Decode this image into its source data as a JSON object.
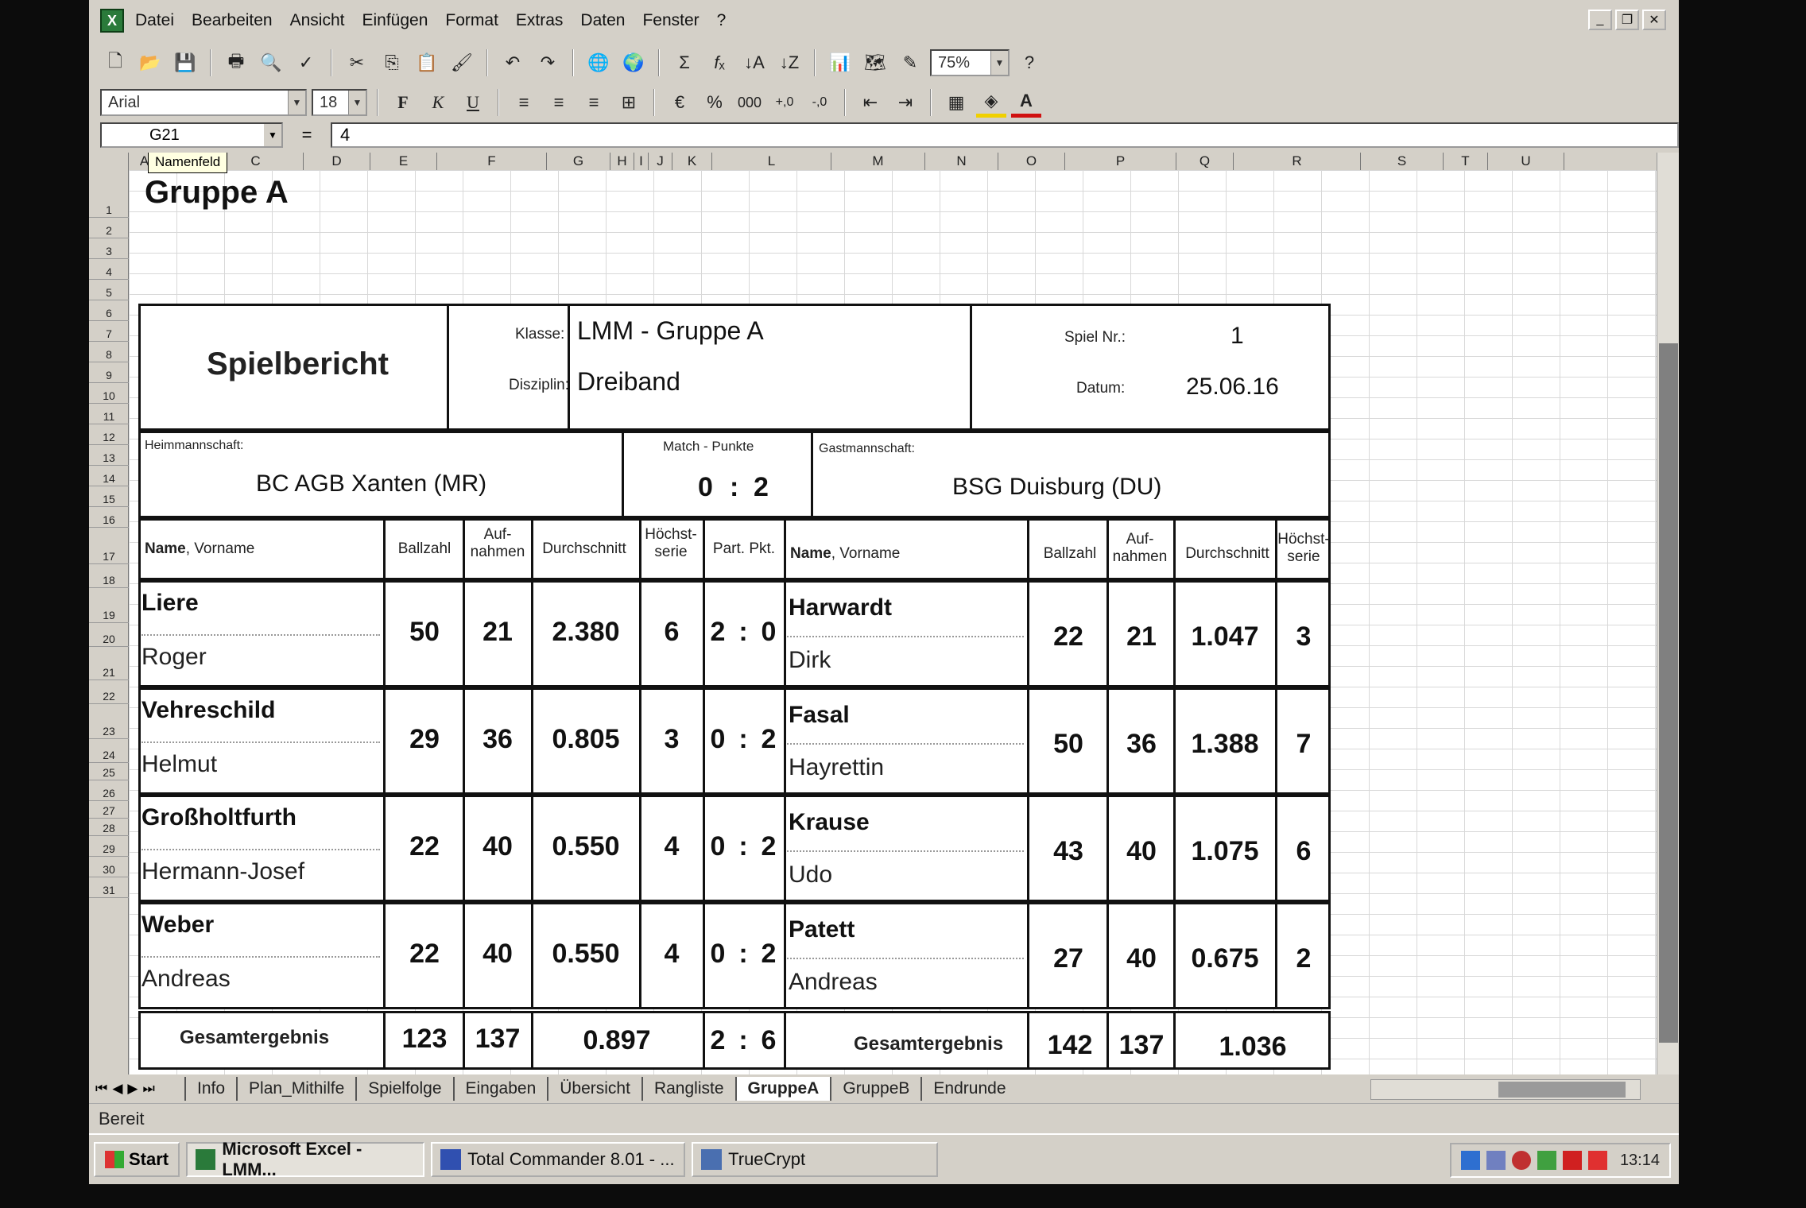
{
  "menu": [
    "Datei",
    "Bearbeiten",
    "Ansicht",
    "Einfügen",
    "Format",
    "Extras",
    "Daten",
    "Fenster",
    "?"
  ],
  "toolbar": {
    "zoom": "75%",
    "font_name": "Arial",
    "font_size": "18",
    "bold": "F",
    "italic": "K",
    "underline": "U"
  },
  "formula_bar": {
    "name_box": "G21",
    "equals": "=",
    "value": "4",
    "tooltip": "Namenfeld"
  },
  "columns": [
    "A",
    "B",
    "C",
    "D",
    "E",
    "F",
    "G",
    "H",
    "I",
    "J",
    "K",
    "L",
    "M",
    "N",
    "O",
    "P",
    "Q",
    "R",
    "S",
    "T",
    "U"
  ],
  "rows": [
    "1",
    "2",
    "3",
    "4",
    "5",
    "6",
    "7",
    "8",
    "9",
    "10",
    "11",
    "12",
    "13",
    "14",
    "15",
    "16",
    "17",
    "18",
    "19",
    "20",
    "21",
    "22",
    "23",
    "24",
    "25",
    "26",
    "27",
    "28",
    "29",
    "30",
    "31"
  ],
  "report": {
    "group_title": "Gruppe A",
    "title": "Spielbericht",
    "klasse_label": "Klasse:",
    "klasse": "LMM - Gruppe A",
    "disziplin_label": "Disziplin:",
    "disziplin": "Dreiband",
    "spiel_nr_label": "Spiel Nr.:",
    "spiel_nr": "1",
    "datum_label": "Datum:",
    "datum": "25.06.16",
    "heim_label": "Heimmannschaft:",
    "heim": "BC AGB Xanten (MR)",
    "match_label": "Match - Punkte",
    "match_home": "0",
    "match_sep": ":",
    "match_away": "2",
    "gast_label": "Gastmannschaft:",
    "gast": "BSG Duisburg (DU)",
    "headers": {
      "name": "Name",
      "vorname": ", Vorname",
      "ballzahl": "Ballzahl",
      "aufnahmen_1": "Auf-",
      "aufnahmen_2": "nahmen",
      "durchschnitt": "Durchschnitt",
      "hoechst_1": "Höchst-",
      "hoechst_2": "serie",
      "partpkt": "Part. Pkt."
    },
    "matches": [
      {
        "home": {
          "surname": "Liere",
          "firstname": "Roger",
          "ballzahl": "50",
          "aufnahmen": "21",
          "durchschnitt": "2.380",
          "hs": "6"
        },
        "pp_home": "2",
        "pp_away": "0",
        "away": {
          "surname": "Harwardt",
          "firstname": "Dirk",
          "ballzahl": "22",
          "aufnahmen": "21",
          "durchschnitt": "1.047",
          "hs": "3"
        }
      },
      {
        "home": {
          "surname": "Vehreschild",
          "firstname": "Helmut",
          "ballzahl": "29",
          "aufnahmen": "36",
          "durchschnitt": "0.805",
          "hs": "3"
        },
        "pp_home": "0",
        "pp_away": "2",
        "away": {
          "surname": "Fasal",
          "firstname": "Hayrettin",
          "ballzahl": "50",
          "aufnahmen": "36",
          "durchschnitt": "1.388",
          "hs": "7"
        }
      },
      {
        "home": {
          "surname": "Großholtfurth",
          "firstname": "Hermann-Josef",
          "ballzahl": "22",
          "aufnahmen": "40",
          "durchschnitt": "0.550",
          "hs": "4"
        },
        "pp_home": "0",
        "pp_away": "2",
        "away": {
          "surname": "Krause",
          "firstname": "Udo",
          "ballzahl": "43",
          "aufnahmen": "40",
          "durchschnitt": "1.075",
          "hs": "6"
        }
      },
      {
        "home": {
          "surname": "Weber",
          "firstname": "Andreas",
          "ballzahl": "22",
          "aufnahmen": "40",
          "durchschnitt": "0.550",
          "hs": "4"
        },
        "pp_home": "0",
        "pp_away": "2",
        "away": {
          "surname": "Patett",
          "firstname": "Andreas",
          "ballzahl": "27",
          "aufnahmen": "40",
          "durchschnitt": "0.675",
          "hs": "2"
        }
      }
    ],
    "total": {
      "label": "Gesamtergebnis",
      "home_ballzahl": "123",
      "home_aufnahmen": "137",
      "home_durchschnitt": "0.897",
      "pp_home": "2",
      "pp_away": "6",
      "away_ballzahl": "142",
      "away_aufnahmen": "137",
      "away_durchschnitt": "1.036"
    }
  },
  "sheet_tabs": [
    "Info",
    "Plan_Mithilfe",
    "Spielfolge",
    "Eingaben",
    "Übersicht",
    "Rangliste",
    "GruppeA",
    "GruppeB",
    "Endrunde"
  ],
  "active_tab": "GruppeA",
  "status": "Bereit",
  "taskbar": {
    "start": "Start",
    "tasks": [
      "Microsoft Excel - LMM...",
      "Total Commander 8.01 - ...",
      "TrueCrypt"
    ],
    "clock": "13:14"
  },
  "colors": {
    "ui_gray": "#d4d0c8",
    "sheet_white": "#ffffff",
    "border_black": "#111111",
    "font_color_red": "#d01010",
    "fill_yellow": "#f0d000"
  }
}
